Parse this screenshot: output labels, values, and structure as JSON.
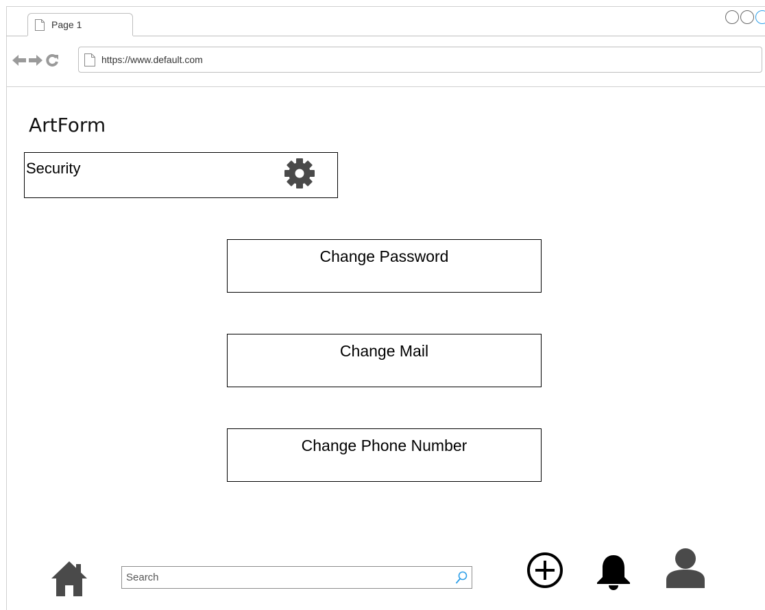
{
  "browser": {
    "tab_label": "Page 1",
    "url": "https://www.default.com"
  },
  "app": {
    "title": "ArtForm"
  },
  "section": {
    "label": "Security",
    "icon": "gear-icon"
  },
  "actions": {
    "change_password": "Change Password",
    "change_mail": "Change Mail",
    "change_phone": "Change Phone Number"
  },
  "bottom_bar": {
    "search_placeholder": "Search",
    "icons": [
      "home-icon",
      "search-icon",
      "plus-circle-icon",
      "bell-icon",
      "user-icon"
    ]
  },
  "colors": {
    "icon_dark": "#4a4a4a",
    "search_icon": "#2c9ee8",
    "border": "#000000"
  }
}
